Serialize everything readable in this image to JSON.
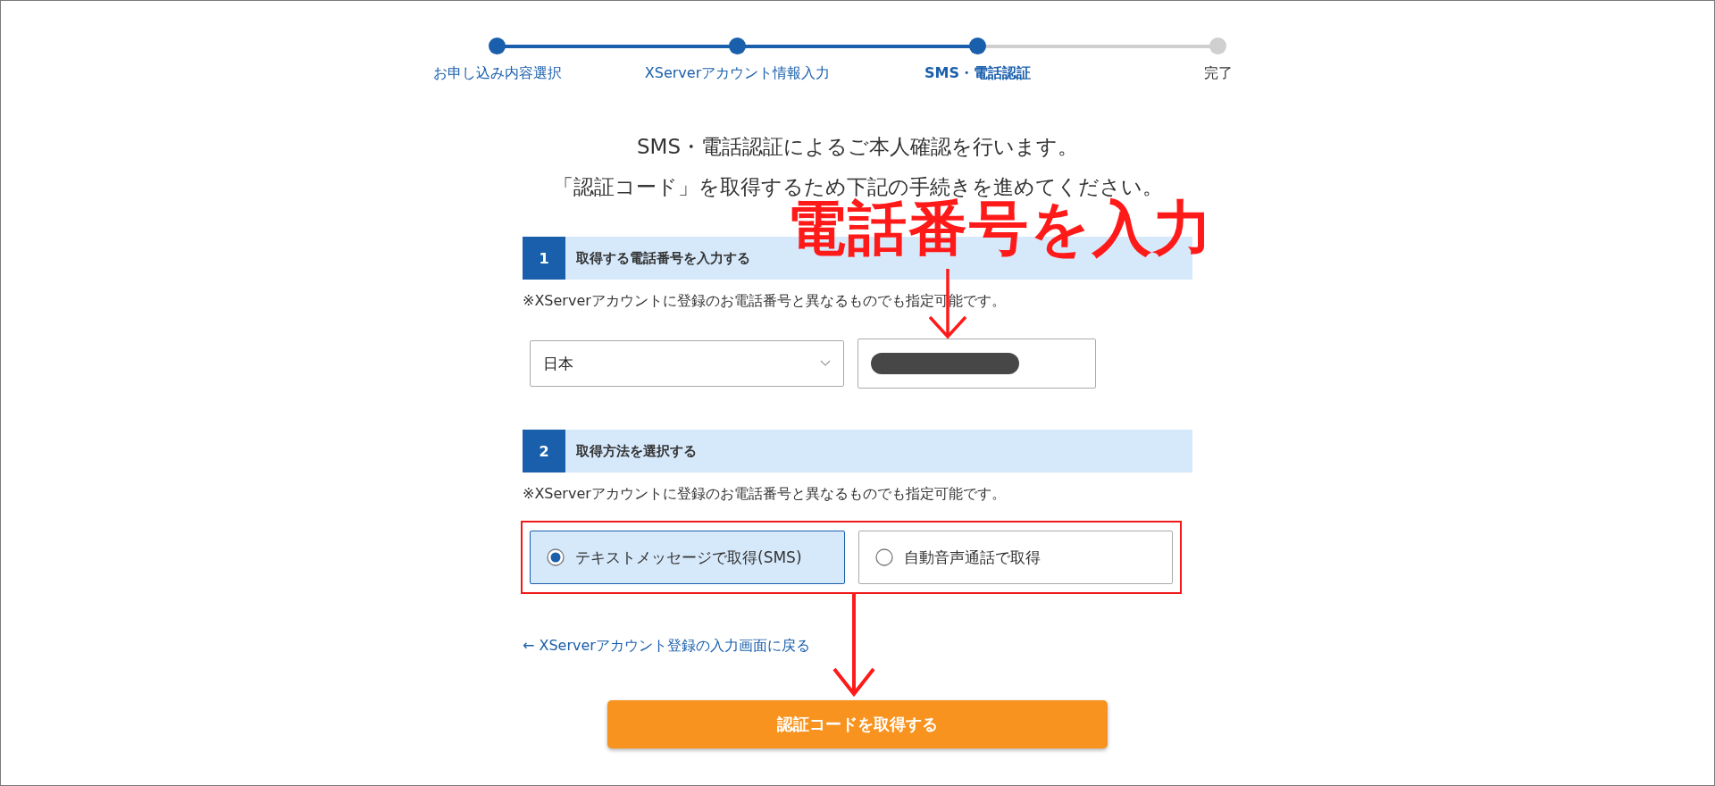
{
  "stepper": {
    "steps": [
      {
        "label": "お申し込み内容選択",
        "done": true,
        "current": false
      },
      {
        "label": "XServerアカウント情報入力",
        "done": true,
        "current": false
      },
      {
        "label": "SMS・電話認証",
        "done": true,
        "current": true
      },
      {
        "label": "完了",
        "done": false,
        "current": false
      }
    ]
  },
  "intro": [
    "SMS・電話認証によるご本人確認を行います。",
    "「認証コード」を取得するため下記の手続きを進めてください。"
  ],
  "sections": [
    {
      "number": "1",
      "title": "取得する電話番号を入力する",
      "note": "※XServerアカウントに登録のお電話番号と異なるものでも指定可能です。",
      "kind": "phone",
      "country": "日本"
    },
    {
      "number": "2",
      "title": "取得方法を選択する",
      "note": "※XServerアカウントに登録のお電話番号と異なるものでも指定可能です。",
      "kind": "method",
      "options": [
        {
          "label": "テキストメッセージで取得(SMS)",
          "selected": true
        },
        {
          "label": "自動音声通話で取得",
          "selected": false
        }
      ]
    }
  ],
  "back_link": "← XServerアカウント登録の入力画面に戻る",
  "submit_button": "認証コードを取得する",
  "annotation": {
    "text": "電話番号を入力"
  }
}
